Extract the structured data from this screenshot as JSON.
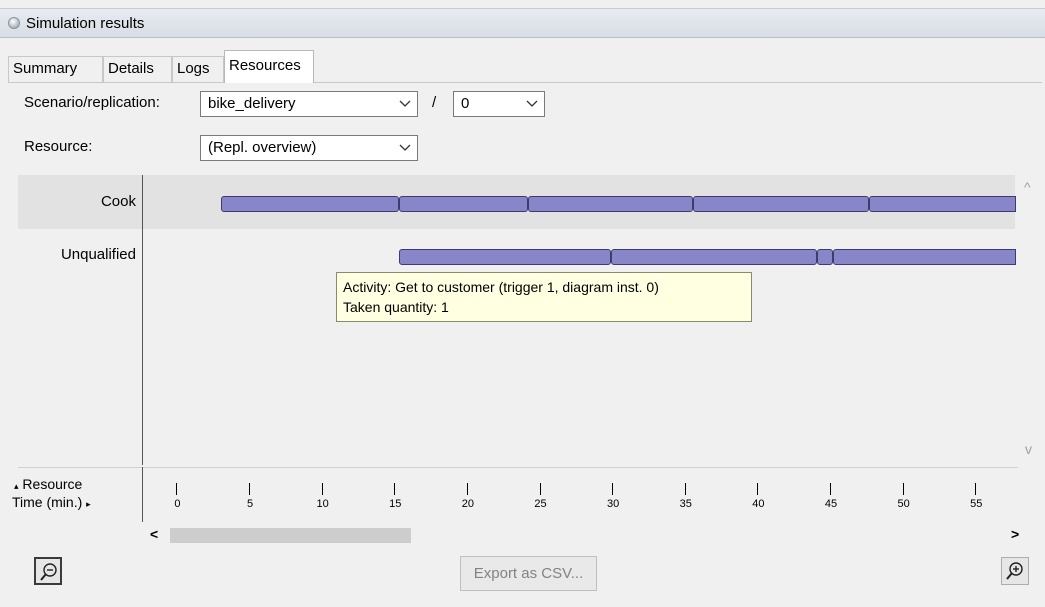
{
  "window": {
    "title": "Simulation results",
    "title_icon": "circle-icon"
  },
  "tabs": [
    {
      "label": "Summary",
      "active": false
    },
    {
      "label": "Details",
      "active": false
    },
    {
      "label": "Logs",
      "active": false
    },
    {
      "label": "Resources",
      "active": true
    }
  ],
  "form": {
    "scenario_label": "Scenario/replication:",
    "scenario_value": "bike_delivery",
    "separator": "/",
    "replication_value": "0",
    "resource_label": "Resource:",
    "resource_value": "(Repl. overview)"
  },
  "chart_data": {
    "type": "gantt",
    "rows": [
      {
        "name": "Cook",
        "intervals": [
          [
            4.2,
            16.4
          ],
          [
            16.4,
            25.3
          ],
          [
            25.3,
            36.7
          ],
          [
            36.7,
            48.8
          ],
          [
            48.8,
            60
          ]
        ]
      },
      {
        "name": "Unqualified",
        "intervals": [
          [
            16.4,
            31
          ],
          [
            31,
            45.2
          ],
          [
            45.2,
            46.3
          ],
          [
            46.3,
            60
          ]
        ]
      }
    ],
    "x_min": -1.2,
    "x_max": 57.6,
    "xticks": [
      0,
      5,
      10,
      15,
      20,
      25,
      30,
      35,
      40,
      45,
      50,
      55
    ],
    "xlabel": "Time (min.)",
    "ylabel": "Resource"
  },
  "tooltip": {
    "line1": "Activity: Get to customer (trigger 1, diagram inst. 0)",
    "line2": "Taken quantity: 1"
  },
  "axis": {
    "resource_label": "Resource",
    "time_label": "Time (min.)",
    "left_marker": "▴",
    "right_marker": "▸"
  },
  "scroll": {
    "left_glyph": "<",
    "right_glyph": ">",
    "up_glyph": "^",
    "down_glyph": "v"
  },
  "buttons": {
    "export_label": "Export as CSV...",
    "zoom_out_icon": "zoom-out-icon",
    "zoom_in_icon": "zoom-in-icon"
  }
}
